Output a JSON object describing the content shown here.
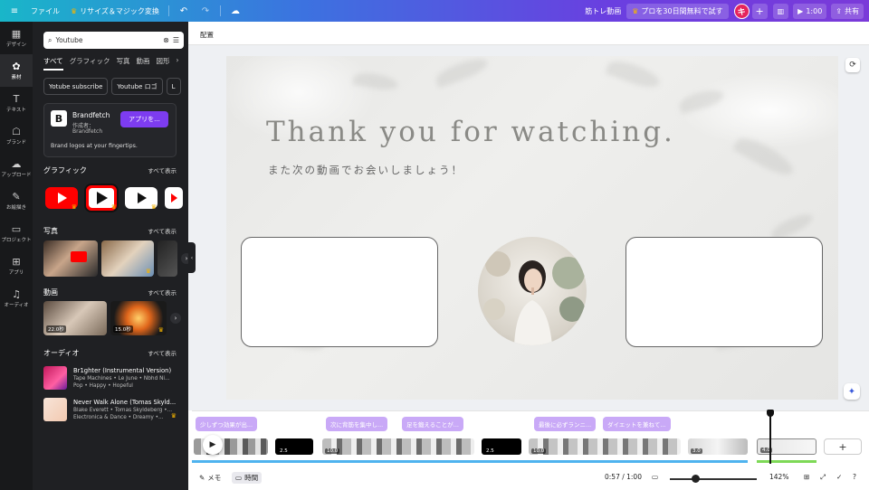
{
  "topbar": {
    "file": "ファイル",
    "resize": "リサイズ＆マジック変換",
    "project_name": "筋トレ動画",
    "promo": "プロを30日間無料で試す",
    "avatar_letter": "キ",
    "play_time": "1:00",
    "share": "共有"
  },
  "rail": [
    {
      "label": "デザイン",
      "icon": "▦"
    },
    {
      "label": "素材",
      "icon": "✿"
    },
    {
      "label": "テキスト",
      "icon": "T"
    },
    {
      "label": "ブランド",
      "icon": "☖"
    },
    {
      "label": "アップロード",
      "icon": "☁"
    },
    {
      "label": "お絵描き",
      "icon": "✎"
    },
    {
      "label": "プロジェクト",
      "icon": "▭"
    },
    {
      "label": "アプリ",
      "icon": "⊞"
    },
    {
      "label": "オーディオ",
      "icon": "♫"
    }
  ],
  "panel": {
    "search_value": "Youtube",
    "tabs": [
      "すべて",
      "グラフィック",
      "写真",
      "動画",
      "図形"
    ],
    "chips": [
      "Yotube subscribe",
      "Youtube ロゴ",
      "L"
    ],
    "brandfetch": {
      "logo": "B",
      "name": "Brandfetch",
      "by_label": "作成者：",
      "by": "Brandfetch",
      "app_button": "アプリを...",
      "desc": "Brand logos at your fingertips."
    },
    "sections": {
      "graphics": "グラフィック",
      "photos": "写真",
      "videos": "動画",
      "audio": "オーディオ",
      "see_all": "すべて表示"
    },
    "videos": [
      {
        "duration": "22.0秒"
      },
      {
        "duration": "15.0秒"
      }
    ],
    "audio": [
      {
        "title": "Br1ghter (Instrumental Version)",
        "artists": "Tape Machines • Le June • Nbhd Ni...",
        "tags": "Pop • Happy • Hopeful"
      },
      {
        "title": "Never Walk Alone (Tomas Skyld...",
        "artists": "Blake Everett • Tomas Skyldeberg •...",
        "tags": "Electronica & Dance • Dreamy •..."
      }
    ]
  },
  "editor": {
    "layout_label": "配置",
    "canvas_title": "Thank you for watching.",
    "canvas_subtitle": "また次の動画でお会いしましょう！"
  },
  "timeline": {
    "notes": [
      "少しずつ効果が出...",
      "次に背筋を集中し...",
      "足を鍛えることが...",
      "最後に必ずランニ...",
      "ダイエットを兼ねて..."
    ],
    "clips": [
      "2.5",
      "10.0",
      "2.5",
      "10.0",
      "3.0",
      "4.0"
    ]
  },
  "bottombar": {
    "memo": "メモ",
    "time_mode": "時間",
    "time": "0:57 / 1:00",
    "zoom": "142%"
  },
  "colors": {
    "accent": "#7d3cf0",
    "youtube_red": "#ff0000",
    "note": "#c9a9f7"
  }
}
